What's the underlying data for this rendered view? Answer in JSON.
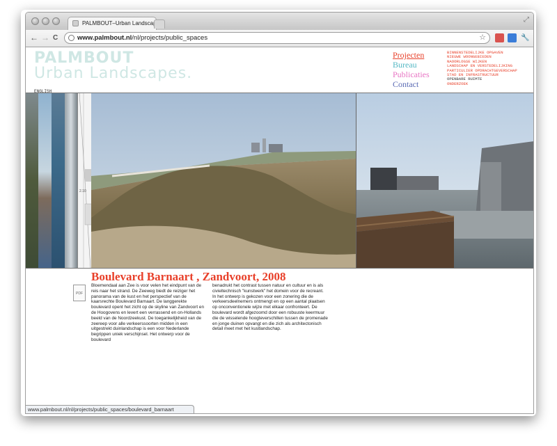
{
  "browser": {
    "tab_title": "PALMBOUT–Urban Landscape",
    "url_host": "www.palmbout.nl",
    "url_path": "/nl/projects/public_spaces",
    "status_url": "www.palmbout.nl/nl/projects/public_spaces/boulevard_barnaart",
    "nav": {
      "back": "←",
      "forward": "→",
      "reload": "C",
      "star": "☆",
      "wrench": "🔧"
    }
  },
  "site": {
    "logo_line1": "PALMBOUT",
    "logo_line2": "Urban Landscapes.",
    "lang_link": "ENGLISH",
    "main_nav": [
      {
        "label": "Projecten",
        "color": "#e8402a",
        "underline": true
      },
      {
        "label": "Bureau",
        "color": "#54b8c4"
      },
      {
        "label": "Publicaties",
        "color": "#e874c4"
      },
      {
        "label": "Contact",
        "color": "#5a6ab4"
      }
    ],
    "sub_nav": [
      "BINNENSTEDELIJKE OPGAVEN",
      "NIEUWE WOONGEBIEDEN",
      "NAOORLOGSE WIJKEN",
      "LANDSCHAP EN VERSTEDELIJKING",
      "PARTICULIER OPDRACHTGEVERSCHAP",
      "STAD EN INFRASTRUCTUUR",
      "OPENBARE RUIMTE",
      "ONDERZOEK"
    ],
    "sub_nav_active_index": 6,
    "sub_nav_colors": {
      "default": "#e8402a",
      "active": "#333333"
    }
  },
  "project": {
    "title": "Boulevard Barnaart , Zandvoort, 2008",
    "pdf_label": "PDF",
    "column1": "Bloemendaal aan Zee is voor velen het eindpunt van de reis naar het strand. De Zeeweg biedt de reiziger het panorama van de kust en het perspectief van de kaarsrechte Boulevard Barnaart. De langgerekte boulevard opent het zicht op de skyline van Zandvoort en de Hoogovens en levert een verrassend en on-Hollands beeld van de Noordzeekust. De toegankelijkheid van de zeereep voor alle verkeerssoorten midden in een uitgestrekt duinlandschap is een voor Nederlande begrippen uniek verschijnsel. Het ontwerp voor de boulevard",
    "column2_p1": "benadrukt het contrast tussen natuur en cultuur en is als civieltechnisch \"kunstwerk\" het domein voor de recreant.",
    "column2_p2": "In het ontwerp is gekozen voor een zonering die de verkeersdeelnemers ontmengt en op een aantal plaatsen op onconventionele wijze met elkaar confronteert. De boulevard wordt afgezoomd door een robuuste keermuur die de wisselende hoogteverschillen tussen de promenade en jonge duinen opvangt en die zich als architectonisch detail meet met het kustlandschap.",
    "drawing_label": "2.10"
  }
}
